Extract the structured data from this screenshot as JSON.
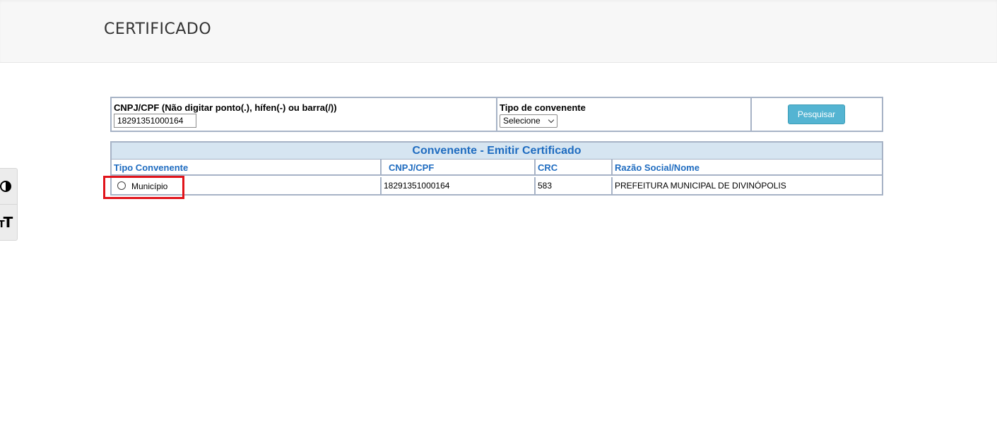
{
  "header": {
    "title": "CERTIFICADO"
  },
  "accessibility": {
    "contrast_icon": "contrast-icon",
    "font_size_icon": "font-size-icon"
  },
  "search": {
    "cnpj_label": "CNPJ/CPF (Não digitar ponto(.), hífen(-) ou barra(/))",
    "cnpj_value": "18291351000164",
    "tipo_label": "Tipo de convenente",
    "tipo_selected": "Selecione",
    "button_label": "Pesquisar"
  },
  "results": {
    "caption": "Convenente - Emitir Certificado",
    "columns": [
      "Tipo Convenente",
      "CNPJ/CPF",
      "CRC",
      "Razão Social/Nome"
    ],
    "rows": [
      {
        "tipo": "Município",
        "cnpj": "18291351000164",
        "crc": "583",
        "razao_social": "PREFEITURA MUNICIPAL DE DIVINÓPOLIS",
        "selected": false
      }
    ]
  },
  "colors": {
    "header_blue": "#1f6cc0",
    "caption_bg": "#d6e5f1",
    "button_bg": "#54b4d2",
    "highlight": "#e1141b"
  }
}
